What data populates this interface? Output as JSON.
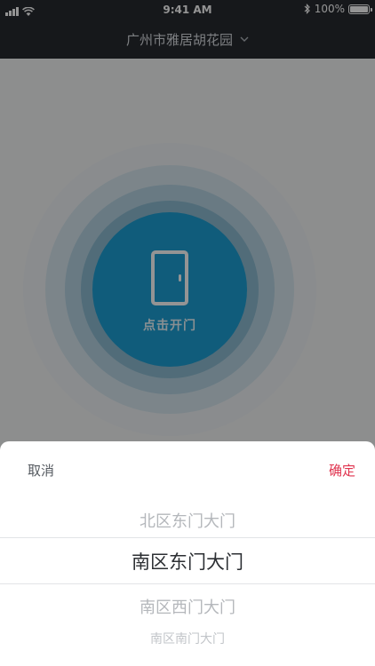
{
  "status_bar": {
    "time": "9:41 AM",
    "battery": "100%",
    "battery_level": 1.0
  },
  "header": {
    "community": "广州市雅居胡花园",
    "dropdown_icon": "chevron-down-icon"
  },
  "main": {
    "door_button_label": "点击开门",
    "door_icon": "door-icon",
    "colors": {
      "button": "#1d9fd4",
      "ring": "#b5d3e2"
    }
  },
  "picker": {
    "cancel": "取消",
    "confirm": "确定",
    "confirm_color": "#e0344f",
    "selected": "南区东门大门",
    "options": [
      "北区东门大门",
      "南区东门大门",
      "南区西门大门",
      "南区南门大门"
    ]
  }
}
